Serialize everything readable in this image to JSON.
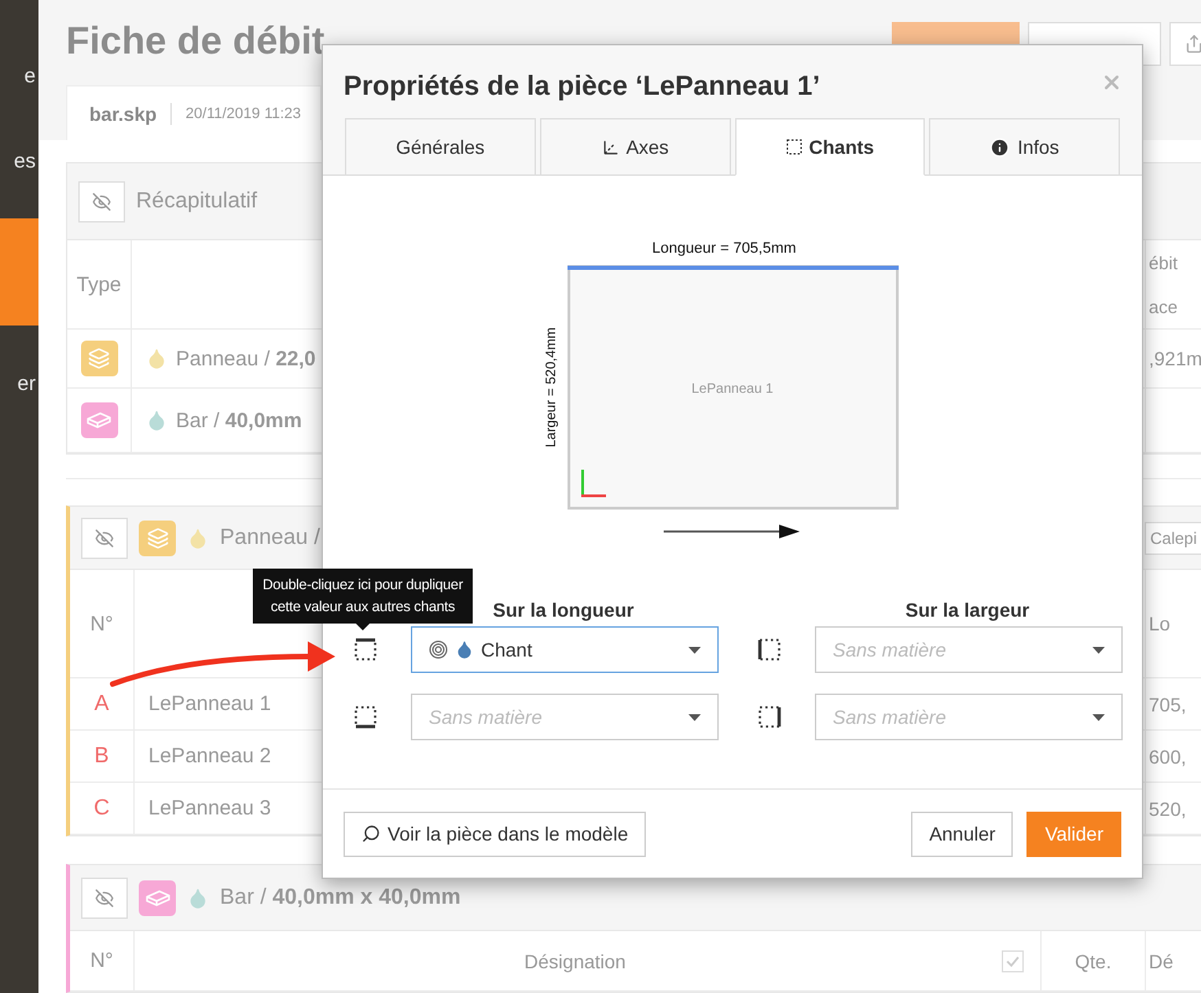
{
  "sidebar": {
    "items": [
      {
        "label": "e",
        "selected": false
      },
      {
        "label": "es",
        "selected": false
      },
      {
        "selected": true
      },
      {
        "label": "er",
        "selected": false
      }
    ]
  },
  "header": {
    "title": "Fiche de débit",
    "actions": [
      {
        "kind": "generate"
      },
      {
        "kind": "print"
      },
      {
        "kind": "share"
      }
    ]
  },
  "file_tab": {
    "name": "bar.skp",
    "date": "20/11/2019 11:23"
  },
  "summary": {
    "title": "Récapitulatif",
    "column": "Type",
    "right_headers": [
      "ébit",
      "ace"
    ],
    "rows": [
      {
        "kind": "panel",
        "color": "#f5cf7e",
        "drop": {
          "color": "#f3e2a6"
        },
        "label": "Panneau / **22,0**",
        "right": ",921m"
      },
      {
        "kind": "bar",
        "color": "#f7a8d6",
        "drop": {
          "color": "#b9dcd8"
        },
        "label": "Bar / **40,0mm**"
      }
    ]
  },
  "groups": [
    {
      "kind": "panel",
      "color": "#f5cf7e",
      "drop": {
        "color": "#f3e2a6"
      },
      "title": "Panneau /",
      "action": "Calepi",
      "columns": [
        {
          "kind": "num",
          "label": "N°"
        },
        {
          "kind": "right",
          "label": "Lo"
        }
      ],
      "rows": [
        {
          "letter": "A",
          "name": "LePanneau 1",
          "length": "705,"
        },
        {
          "letter": "B",
          "name": "LePanneau 2",
          "length": "600,"
        },
        {
          "letter": "C",
          "name": "LePanneau 3",
          "length": "520,"
        }
      ]
    },
    {
      "kind": "bar",
      "color": "#f7a8d6",
      "drop": {
        "color": "#b9dcd8"
      },
      "title": "Bar / **40,0mm x 40,0mm**",
      "columns": [
        {
          "kind": "num",
          "label": "N°"
        },
        {
          "kind": "name",
          "label": "Désignation"
        },
        {
          "kind": "check",
          "checked": true
        },
        {
          "kind": "qty",
          "label": "Qte."
        },
        {
          "kind": "right",
          "label": "Dé"
        }
      ]
    }
  ],
  "dialog": {
    "title": "Propriétés de la pièce ‘LePanneau 1’",
    "tabs": [
      {
        "kind": "plain",
        "label": "Générales",
        "selected": false
      },
      {
        "kind": "axes",
        "label": "Axes",
        "selected": false
      },
      {
        "kind": "edges",
        "label": "Chants",
        "selected": true
      },
      {
        "kind": "info",
        "label": "Infos",
        "selected": false
      }
    ],
    "diagram": {
      "length_label": "Longueur = 705,5mm",
      "width_label": "Largeur = 520,4mm",
      "piece_label": "LePanneau 1"
    },
    "edges": {
      "columns": [
        {
          "title": "Sur la longueur",
          "rows": [
            {
              "kind": "top",
              "select": {
                "value": "Chant",
                "focused": true
              }
            },
            {
              "kind": "bottom",
              "select": {
                "placeholder": "Sans matière",
                "focused": false
              }
            }
          ]
        },
        {
          "title": "Sur la largeur",
          "rows": [
            {
              "kind": "left",
              "select": {
                "placeholder": "Sans matière",
                "focused": false
              }
            },
            {
              "kind": "right",
              "select": {
                "placeholder": "Sans matière",
                "focused": false
              }
            }
          ]
        }
      ]
    },
    "footer": {
      "locate": "Voir la pièce dans le modèle",
      "cancel": "Annuler",
      "confirm": "Valider"
    }
  },
  "tooltip": "Double-cliquez ici pour dupliquer cette valeur aux autres chants"
}
